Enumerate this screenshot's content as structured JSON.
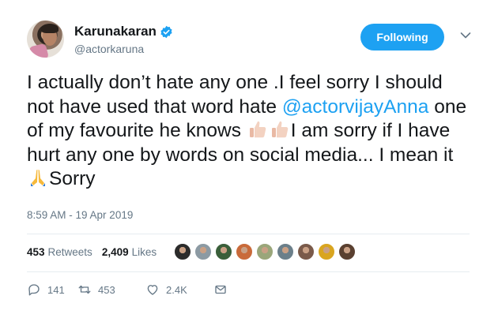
{
  "tweet": {
    "author": {
      "display_name": "Karunakaran",
      "handle": "@actorkaruna",
      "verified": true,
      "avatar_icon": "profile-photo"
    },
    "follow_button": {
      "label": "Following",
      "state": "following",
      "color": "#1da1f2"
    },
    "menu_icon": "chevron-down-icon",
    "text": {
      "line_1": "I actually don’t hate any one .I feel sorry I should not have used that word hate ",
      "mention": "@actorvijayAnna",
      "line_2": " one of my favourite he knows ",
      "emoji_1": "thumbs-up-light-skin",
      "emoji_2": "thumbs-up-light-skin",
      "line_3": "I am sorry if I have hurt any one by words on social media... I mean it ",
      "emoji_3": "folded-hands",
      "line_4": "Sorry"
    },
    "timestamp": "8:59 AM - 19 Apr 2019",
    "stats": {
      "retweets_count": "453",
      "retweets_label": "Retweets",
      "likes_count": "2,409",
      "likes_label": "Likes"
    },
    "likers": [
      {
        "color": "#2b2b2b"
      },
      {
        "color": "#8c9aa3"
      },
      {
        "color": "#3a5f3a"
      },
      {
        "color": "#c96a3a"
      },
      {
        "color": "#9aa67a"
      },
      {
        "color": "#6b7f8a"
      },
      {
        "color": "#7a5a4a"
      },
      {
        "color": "#d9a520"
      },
      {
        "color": "#5a4030"
      }
    ],
    "actions": {
      "reply_count": "141",
      "retweet_count": "453",
      "like_count": "2.4K"
    }
  },
  "colors": {
    "accent": "#1da1f2",
    "text": "#14171a",
    "muted": "#657786",
    "divider": "#e6ecf0"
  }
}
